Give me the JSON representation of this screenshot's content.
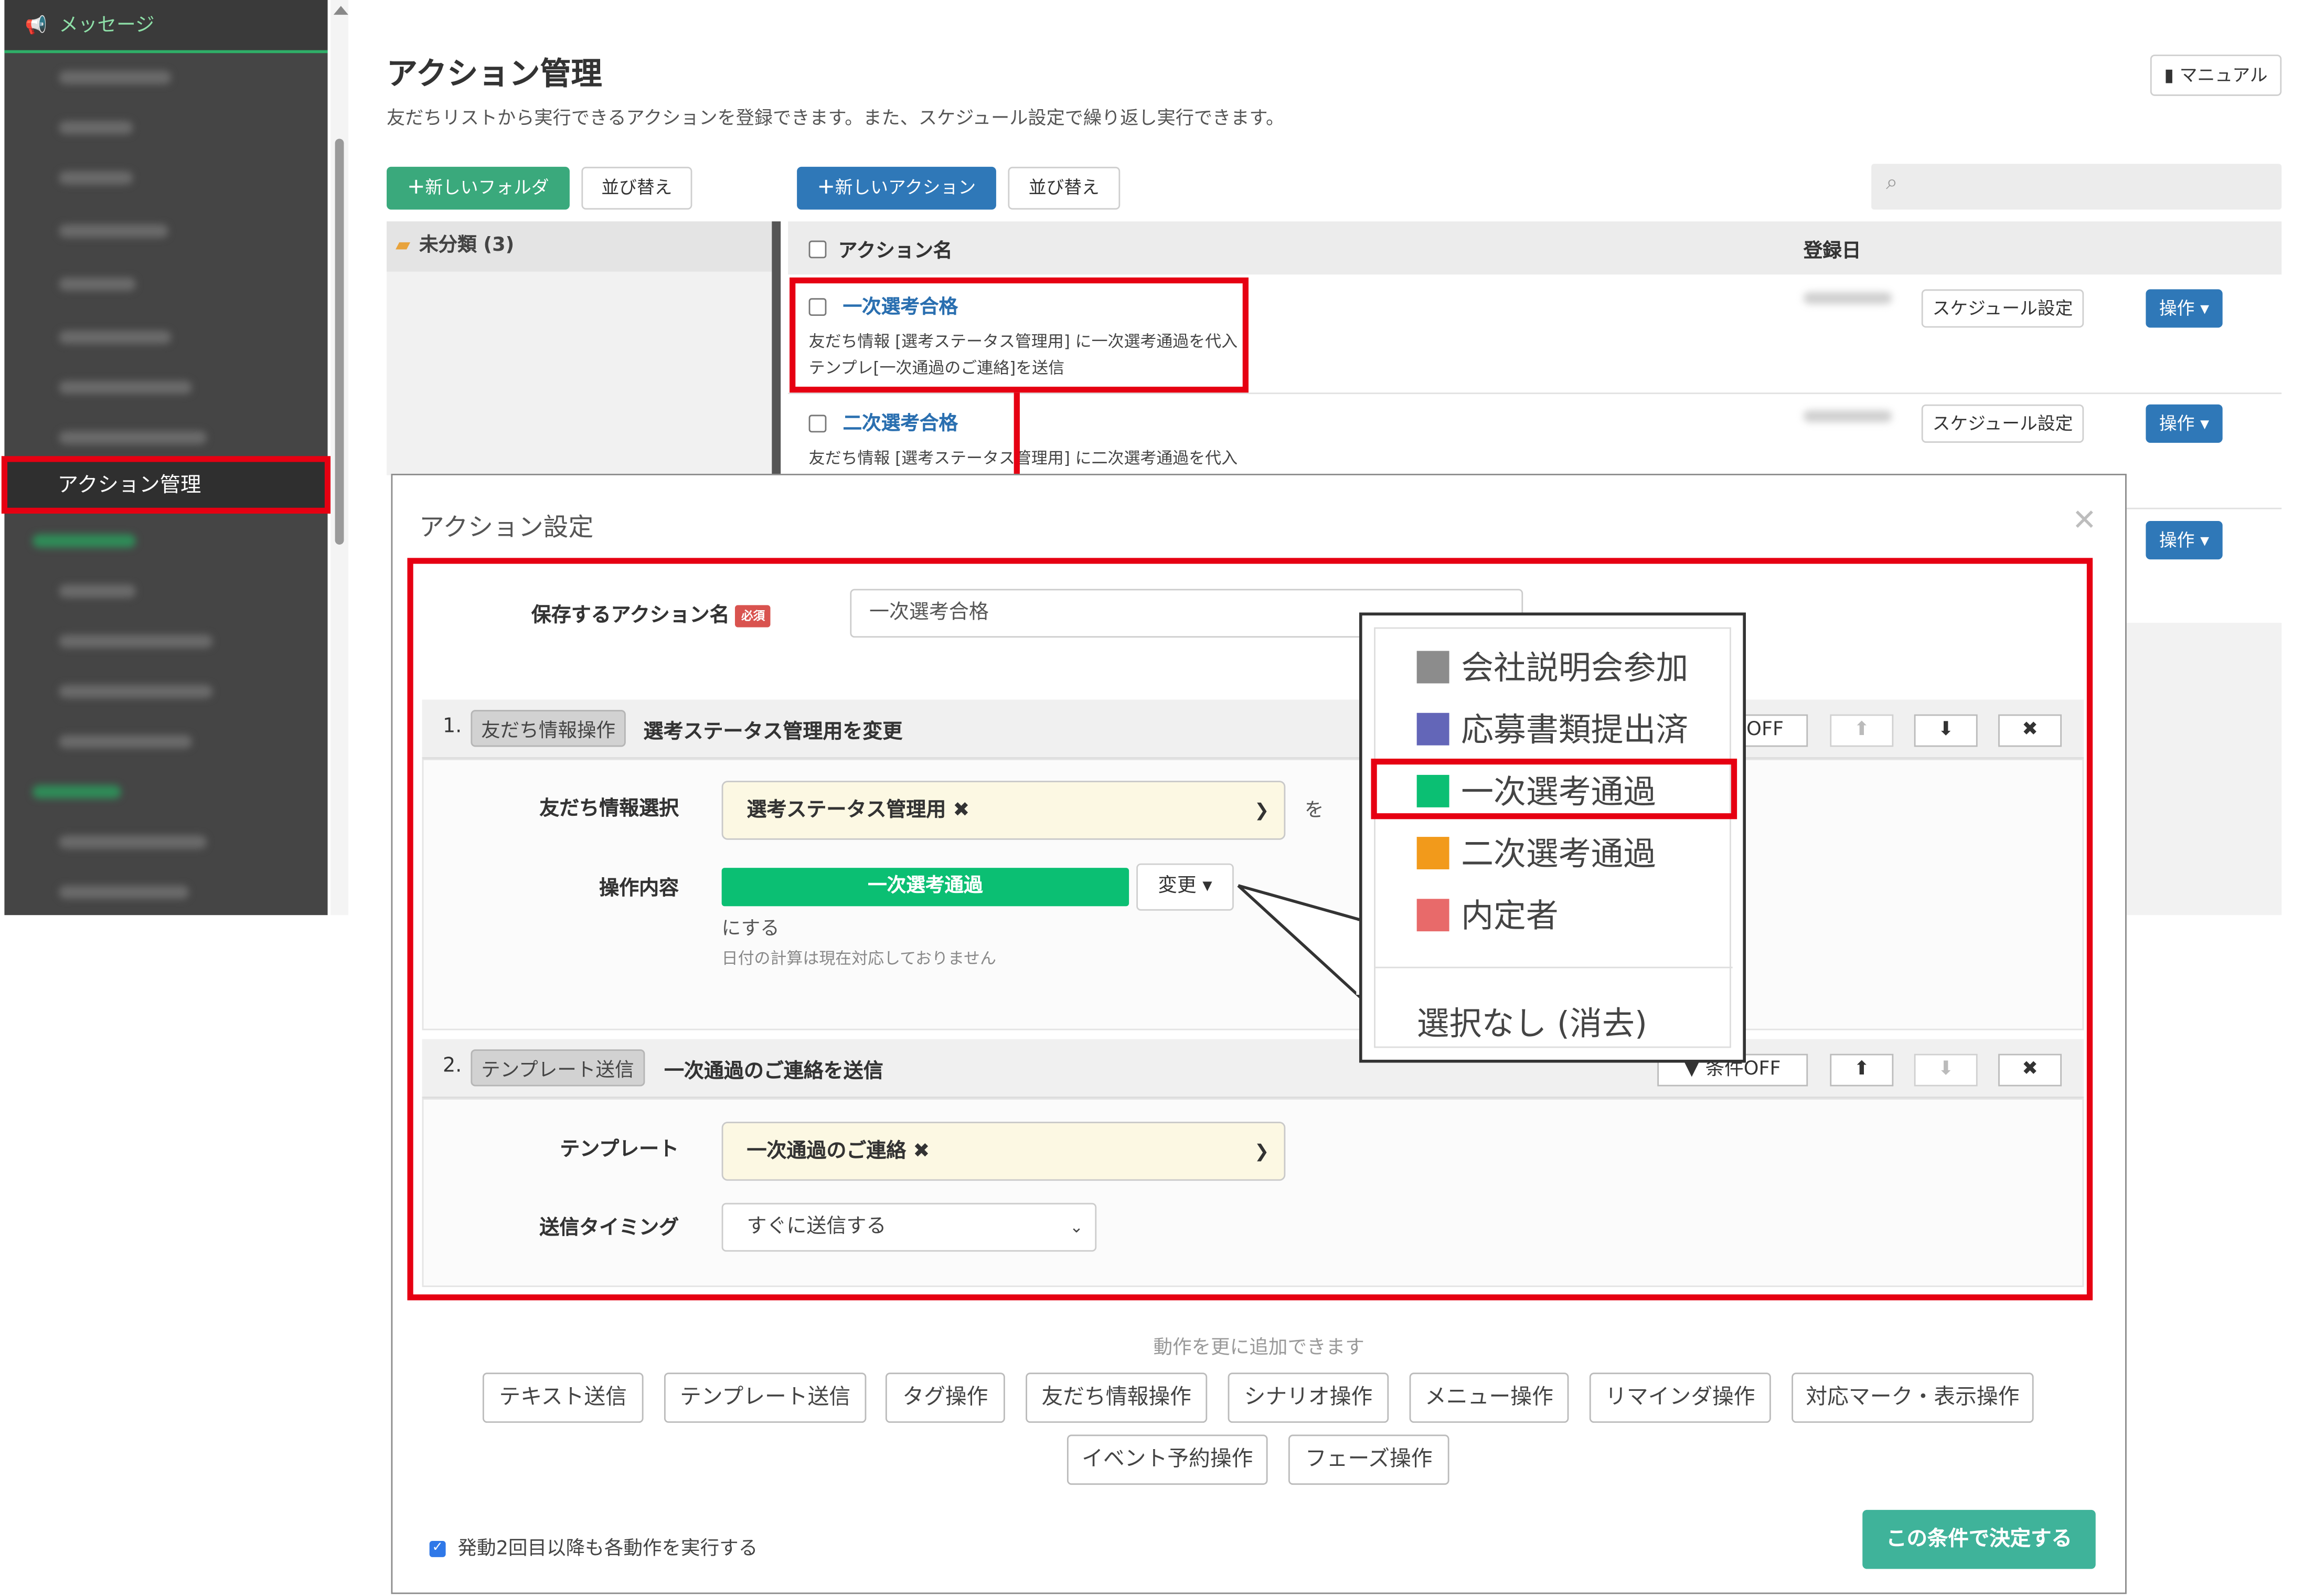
{
  "sidebar": {
    "header": "メッセージ",
    "active_item": "アクション管理"
  },
  "page": {
    "title": "アクション管理",
    "description": "友だちリストから実行できるアクションを登録できます。また、スケジュール設定で繰り返し実行できます。",
    "manual_button": "マニュアル",
    "new_folder_button": "新しいフォルダ",
    "sort_button_1": "並び替え",
    "new_action_button": "新しいアクション",
    "sort_button_2": "並び替え"
  },
  "folder": {
    "uncategorized": "未分類 (3)"
  },
  "list": {
    "col_name": "アクション名",
    "col_date": "登録日",
    "rows": [
      {
        "name": "一次選考合格",
        "line1": "友だち情報 [選考ステータス管理用] に一次選考通過を代入",
        "line2": "テンプレ[一次通過のご連絡]を送信",
        "schedule": "スケジュール設定",
        "op": "操作"
      },
      {
        "name": "二次選考合格",
        "line1": "友だち情報 [選考ステータス管理用] に二次選考通過を代入",
        "schedule": "スケジュール設定",
        "op": "操作"
      },
      {
        "op": "操作"
      }
    ]
  },
  "modal": {
    "title": "アクション設定",
    "name_label": "保存するアクション名",
    "required": "必須",
    "name_value": "一次選考合格",
    "step1": {
      "num": "1.",
      "tag": "友だち情報操作",
      "title": "選考ステータス管理用を変更",
      "cond_off": "OFF",
      "field_label": "友だち情報選択",
      "field_value": "選考ステータス管理用",
      "wo": "を",
      "op_label": "操作内容",
      "op_value": "一次選考通過",
      "change_btn": "変更",
      "suffix": "にする",
      "note": "日付の計算は現在対応しておりません"
    },
    "step2": {
      "num": "2.",
      "tag": "テンプレート送信",
      "title": "一次通過のご連絡を送信",
      "cond_off": "条件OFF",
      "template_label": "テンプレート",
      "template_value": "一次通過のご連絡",
      "timing_label": "送信タイミング",
      "timing_value": "すぐに送信する"
    },
    "add_hint": "動作を更に追加できます",
    "add_buttons": [
      "テキスト送信",
      "テンプレート送信",
      "タグ操作",
      "友だち情報操作",
      "シナリオ操作",
      "メニュー操作",
      "リマインダ操作",
      "対応マーク・表示操作",
      "イベント予約操作",
      "フェーズ操作"
    ],
    "repeat_label": "発動2回目以降も各動作を実行する",
    "submit": "この条件で決定する"
  },
  "popup": {
    "options": [
      {
        "label": "会社説明会参加",
        "color": "#8c8c8c"
      },
      {
        "label": "応募書類提出済",
        "color": "#6366b8"
      },
      {
        "label": "一次選考通過",
        "color": "#0bbf73"
      },
      {
        "label": "二次選考通過",
        "color": "#f29a1b"
      },
      {
        "label": "内定者",
        "color": "#e86a6a"
      }
    ],
    "none": "選択なし (消去)"
  }
}
